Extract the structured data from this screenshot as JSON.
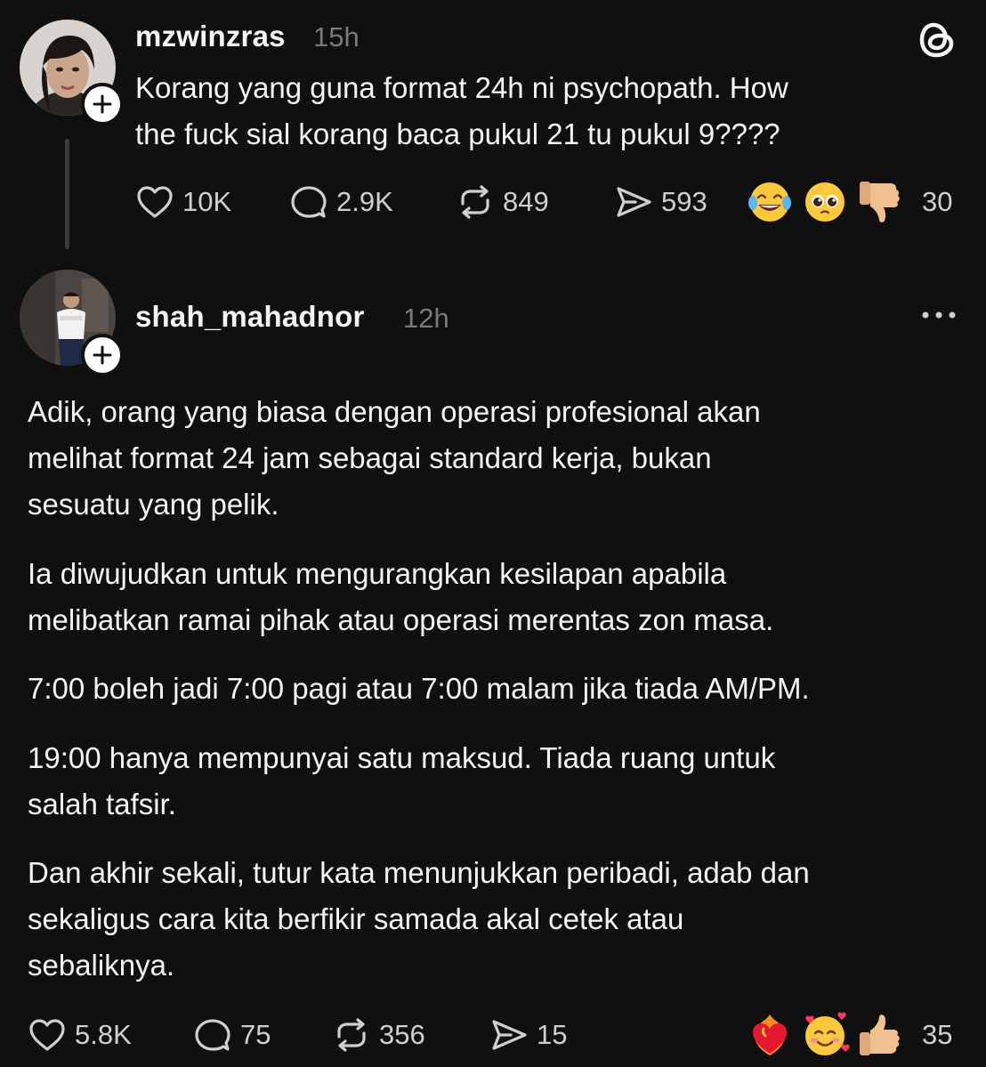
{
  "app": {
    "logo_icon": "threads-logo-icon"
  },
  "post1": {
    "username": "mzwinzras",
    "time": "15h",
    "text_lines": [
      "Korang yang guna format 24h ni psychopath. How",
      "the fuck sial korang baca pukul 21 tu pukul 9????"
    ],
    "likes": "10K",
    "replies": "2.9K",
    "reposts": "849",
    "shares": "593",
    "reactions": [
      "face-with-tears-of-joy",
      "pleading-face",
      "thumbs-down"
    ],
    "reaction_count": "30"
  },
  "post2": {
    "username": "shah_mahadnor",
    "time": "12h",
    "paragraphs": [
      [
        "Adik, orang yang biasa dengan operasi profesional akan",
        "melihat format 24 jam sebagai standard kerja, bukan",
        "sesuatu yang pelik."
      ],
      [
        "Ia diwujudkan untuk mengurangkan kesilapan apabila",
        "melibatkan ramai pihak atau operasi merentas zon masa."
      ],
      [
        "7:00 boleh jadi 7:00 pagi atau 7:00 malam jika tiada AM/PM."
      ],
      [
        "19:00 hanya mempunyai satu maksud. Tiada ruang untuk",
        "salah tafsir."
      ],
      [
        "Dan akhir sekali, tutur kata menunjukkan peribadi, adab dan",
        "sekaligus cara kita berfikir samada akal cetek atau",
        "sebaliknya."
      ]
    ],
    "likes": "5.8K",
    "replies": "75",
    "reposts": "356",
    "shares": "15",
    "reactions": [
      "heart-on-fire",
      "smiling-face-with-hearts",
      "thumbs-up"
    ],
    "reaction_count": "35"
  }
}
